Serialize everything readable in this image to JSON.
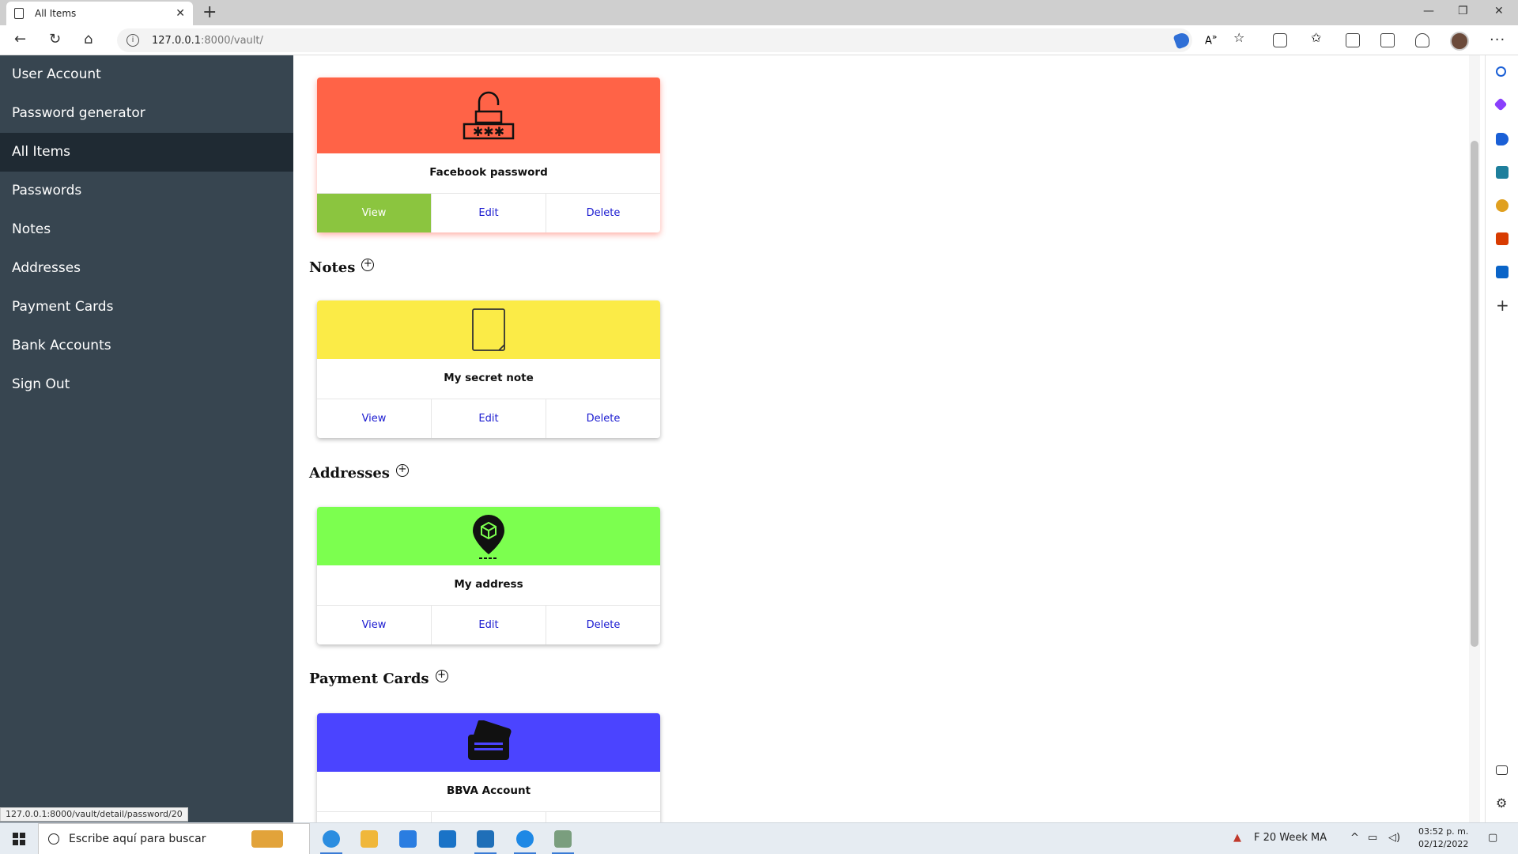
{
  "browser": {
    "tab_title": "All Items",
    "url_host": "127.0.0.1",
    "url_path": ":8000/vault/",
    "status_url": "127.0.0.1:8000/vault/detail/password/20"
  },
  "sidebar": {
    "items": [
      {
        "label": "User Account"
      },
      {
        "label": "Password generator"
      },
      {
        "label": "All Items"
      },
      {
        "label": "Passwords"
      },
      {
        "label": "Notes"
      },
      {
        "label": "Addresses"
      },
      {
        "label": "Payment Cards"
      },
      {
        "label": "Bank Accounts"
      },
      {
        "label": "Sign Out"
      }
    ],
    "active": "All Items"
  },
  "sections": {
    "notes": {
      "heading": "Notes"
    },
    "addresses": {
      "heading": "Addresses"
    },
    "payment_cards": {
      "heading": "Payment Cards"
    }
  },
  "cards": {
    "password": {
      "title": "Facebook password",
      "color": "#ff6347",
      "icon": "padlock-password-icon"
    },
    "note": {
      "title": "My secret note",
      "color": "#fbeb47",
      "icon": "note-paper-icon"
    },
    "address": {
      "title": "My address",
      "color": "#7cff4f",
      "icon": "location-pin-icon"
    },
    "payment": {
      "title": "BBVA Account",
      "color": "#4b44ff",
      "icon": "credit-card-icon"
    }
  },
  "actions": {
    "view": "View",
    "edit": "Edit",
    "delete": "Delete"
  },
  "taskbar": {
    "search_placeholder": "Escribe aquí para buscar",
    "weather": "F  20 Week MA",
    "time": "03:52 p. m.",
    "date": "02/12/2022"
  }
}
